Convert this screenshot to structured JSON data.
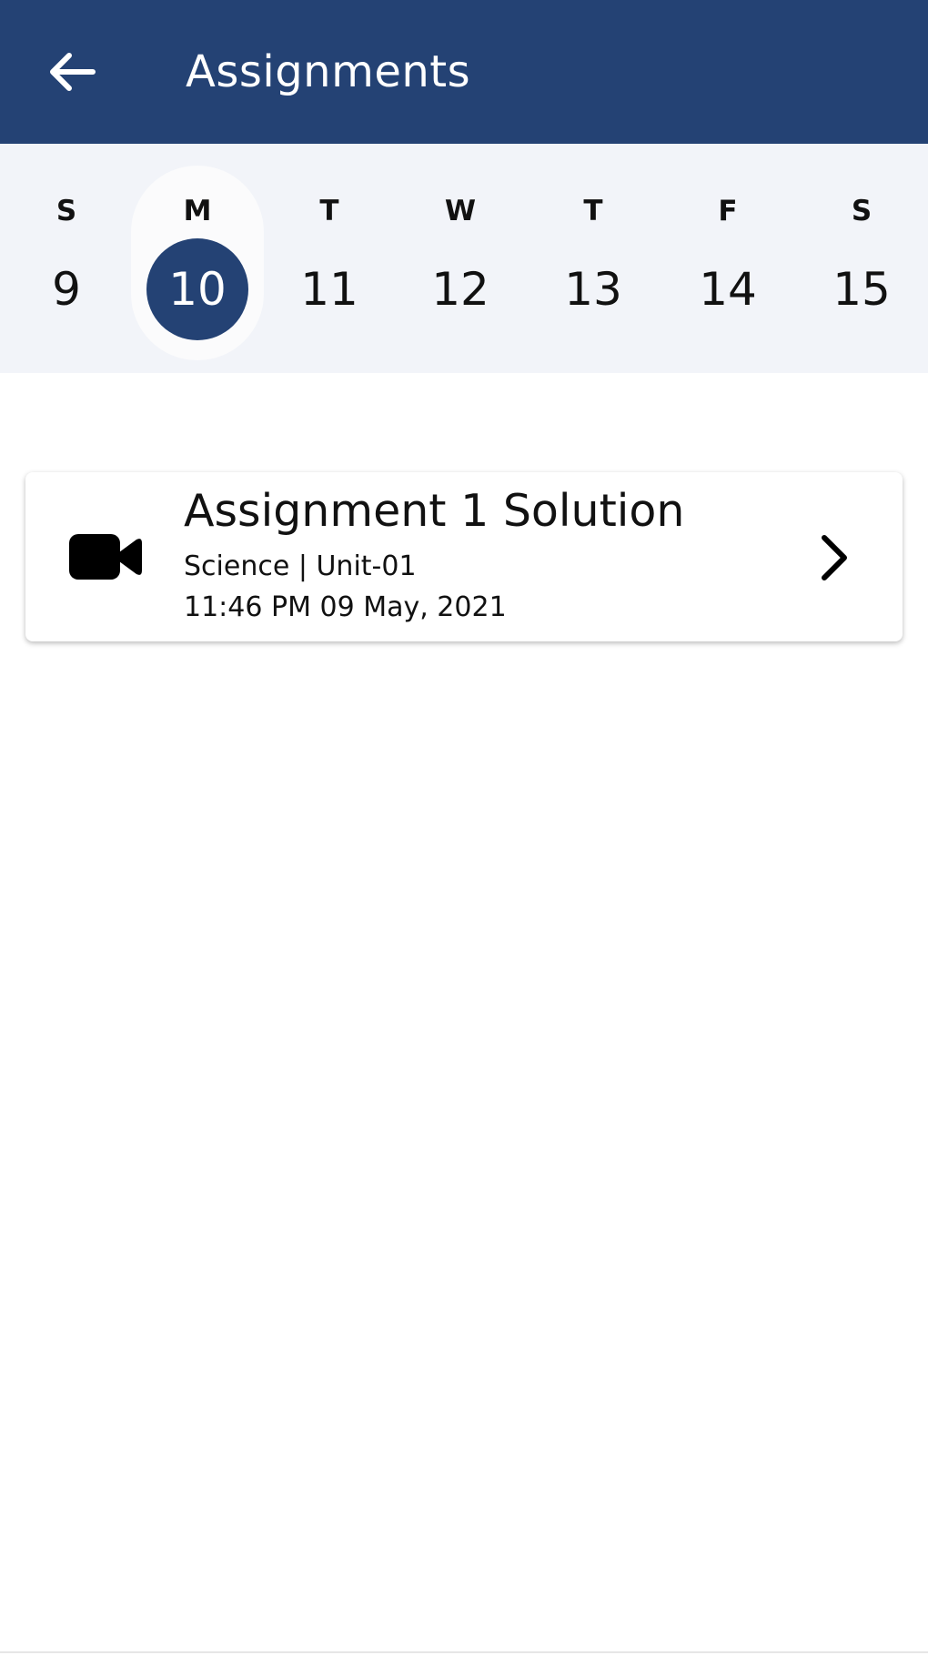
{
  "app_bar": {
    "title": "Assignments",
    "back_icon": "arrow-left-icon"
  },
  "week": [
    {
      "letter": "S",
      "date": "9",
      "selected": false
    },
    {
      "letter": "M",
      "date": "10",
      "selected": true
    },
    {
      "letter": "T",
      "date": "11",
      "selected": false
    },
    {
      "letter": "W",
      "date": "12",
      "selected": false
    },
    {
      "letter": "T",
      "date": "13",
      "selected": false
    },
    {
      "letter": "F",
      "date": "14",
      "selected": false
    },
    {
      "letter": "S",
      "date": "15",
      "selected": false
    }
  ],
  "assignments": [
    {
      "title": "Assignment 1 Solution",
      "subtitle": "Science | Unit-01",
      "datetime": "11:46 PM 09 May, 2021",
      "icon": "video-camera-icon",
      "action_icon": "chevron-right-icon"
    }
  ],
  "colors": {
    "primary": "#244274",
    "strip_background": "#f2f4f9",
    "text": "#111111"
  }
}
